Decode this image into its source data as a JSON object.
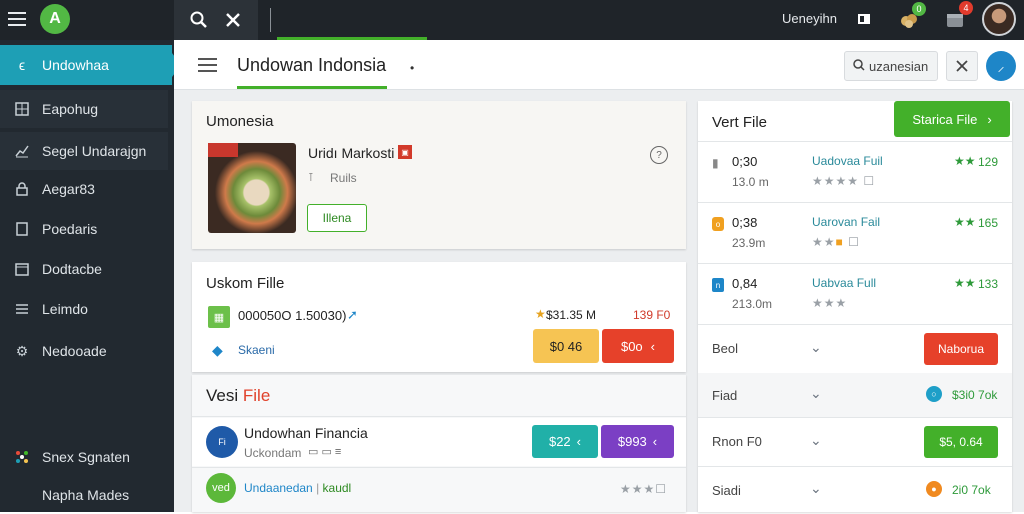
{
  "topbar": {
    "logo_letter": "A",
    "user_name": "Ueneyihn",
    "badge_count_1": "0",
    "badge_count_2": "4"
  },
  "sidebar": {
    "items": [
      {
        "label": "Undowhaa",
        "icon": "home-icon"
      },
      {
        "label": "Eapohug",
        "icon": "grid-icon"
      },
      {
        "label": "Segel Undarajgn",
        "icon": "chart-icon"
      },
      {
        "label": "Aegar83",
        "icon": "lock-icon"
      },
      {
        "label": "Poedaris",
        "icon": "doc-icon"
      },
      {
        "label": "Dodtacbe",
        "icon": "calendar-icon"
      },
      {
        "label": "Leimdo",
        "icon": "list-icon"
      },
      {
        "label": "Nedooade",
        "icon": "gear-icon"
      }
    ],
    "bottom": [
      {
        "label": "Snex Sgnaten",
        "icon": "pinwheel-icon"
      },
      {
        "label": "Napha Mades",
        "icon": ""
      }
    ]
  },
  "header": {
    "title": "Undowan Indonsia",
    "search_label": "uzanesian"
  },
  "card1": {
    "title": "Umonesia",
    "item_name": "Uridı Markosti",
    "item_sub": "Ruils",
    "button": "Illena"
  },
  "card2": {
    "title": "Uskom Fille",
    "row1_text": "000050O 1.50030)",
    "rating": "$31.35 M",
    "price_red": "139 F0",
    "row2_text": "Skaeni",
    "btn_yellow": "$0 46",
    "btn_red": "$0o"
  },
  "card3": {
    "title_a": "Vesi",
    "title_b": "File",
    "item1_title": "Undowhan Financia",
    "item1_sub": "Uckondam",
    "btn_teal": "$22",
    "btn_purple": "$993",
    "item2_a": "Undaanedan",
    "item2_b": "kaudl",
    "avatar2_text": "ved"
  },
  "right": {
    "title": "Vert File",
    "action_button": "Starica File",
    "files": [
      {
        "time": "0;30",
        "size": "13.0 m",
        "name": "Uadovaa Fuil",
        "score": "129"
      },
      {
        "time": "0;38",
        "size": "23.9m",
        "name": "Uarovan Fail",
        "score": "165"
      },
      {
        "time": "0,84",
        "size": "213.0m",
        "name": "Uabvaa Full",
        "score": "133"
      }
    ],
    "rows": [
      {
        "label": "Beol",
        "action": "Naborua"
      },
      {
        "label": "Fiad",
        "value": "$3i0 7ok"
      },
      {
        "label": "Rnon F0",
        "action": "$5, 0.64"
      },
      {
        "label": "Siadi",
        "value": "2i0 7ok"
      }
    ]
  },
  "colors": {
    "accent_teal": "#1fa3b8",
    "green": "#3fb928",
    "red": "#e6412a",
    "yellow": "#f5c451",
    "purple": "#7b3fc4",
    "sidebar_bg": "#222930"
  }
}
